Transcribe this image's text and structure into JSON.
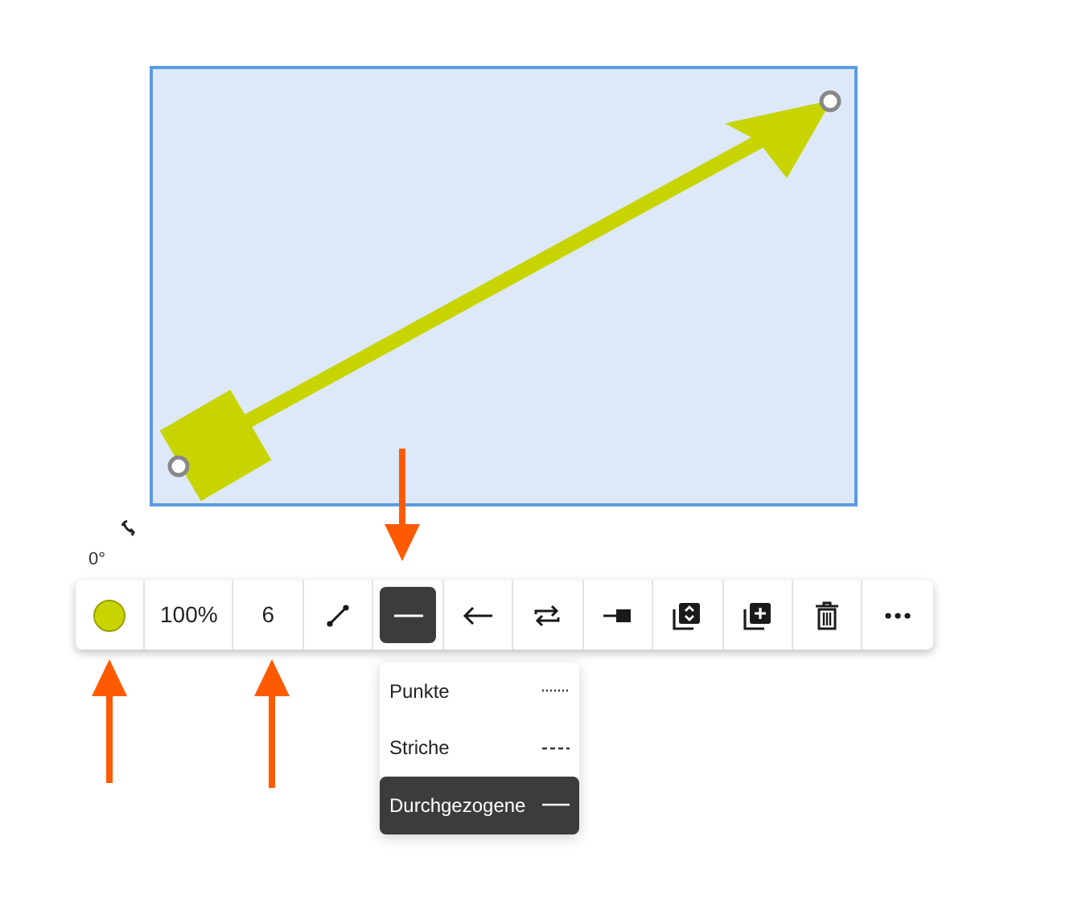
{
  "rotation_label": "0°",
  "shape": {
    "color": "#c8d400"
  },
  "toolbar": {
    "items": [
      {
        "kind": "color",
        "color": "#c8d400"
      },
      {
        "kind": "text",
        "label": "100%"
      },
      {
        "kind": "text",
        "label": "6"
      },
      {
        "kind": "icon",
        "selected": false
      },
      {
        "kind": "icon",
        "selected": true
      },
      {
        "kind": "icon",
        "selected": false
      },
      {
        "kind": "icon",
        "selected": false
      },
      {
        "kind": "icon",
        "selected": false
      },
      {
        "kind": "icon",
        "selected": false
      },
      {
        "kind": "icon",
        "selected": false
      },
      {
        "kind": "icon",
        "selected": false
      },
      {
        "kind": "icon",
        "selected": false
      }
    ]
  },
  "line_style_menu": [
    {
      "label": "Punkte",
      "selected": false
    },
    {
      "label": "Striche",
      "selected": false
    },
    {
      "label": "Durchgezogene",
      "selected": true
    }
  ]
}
